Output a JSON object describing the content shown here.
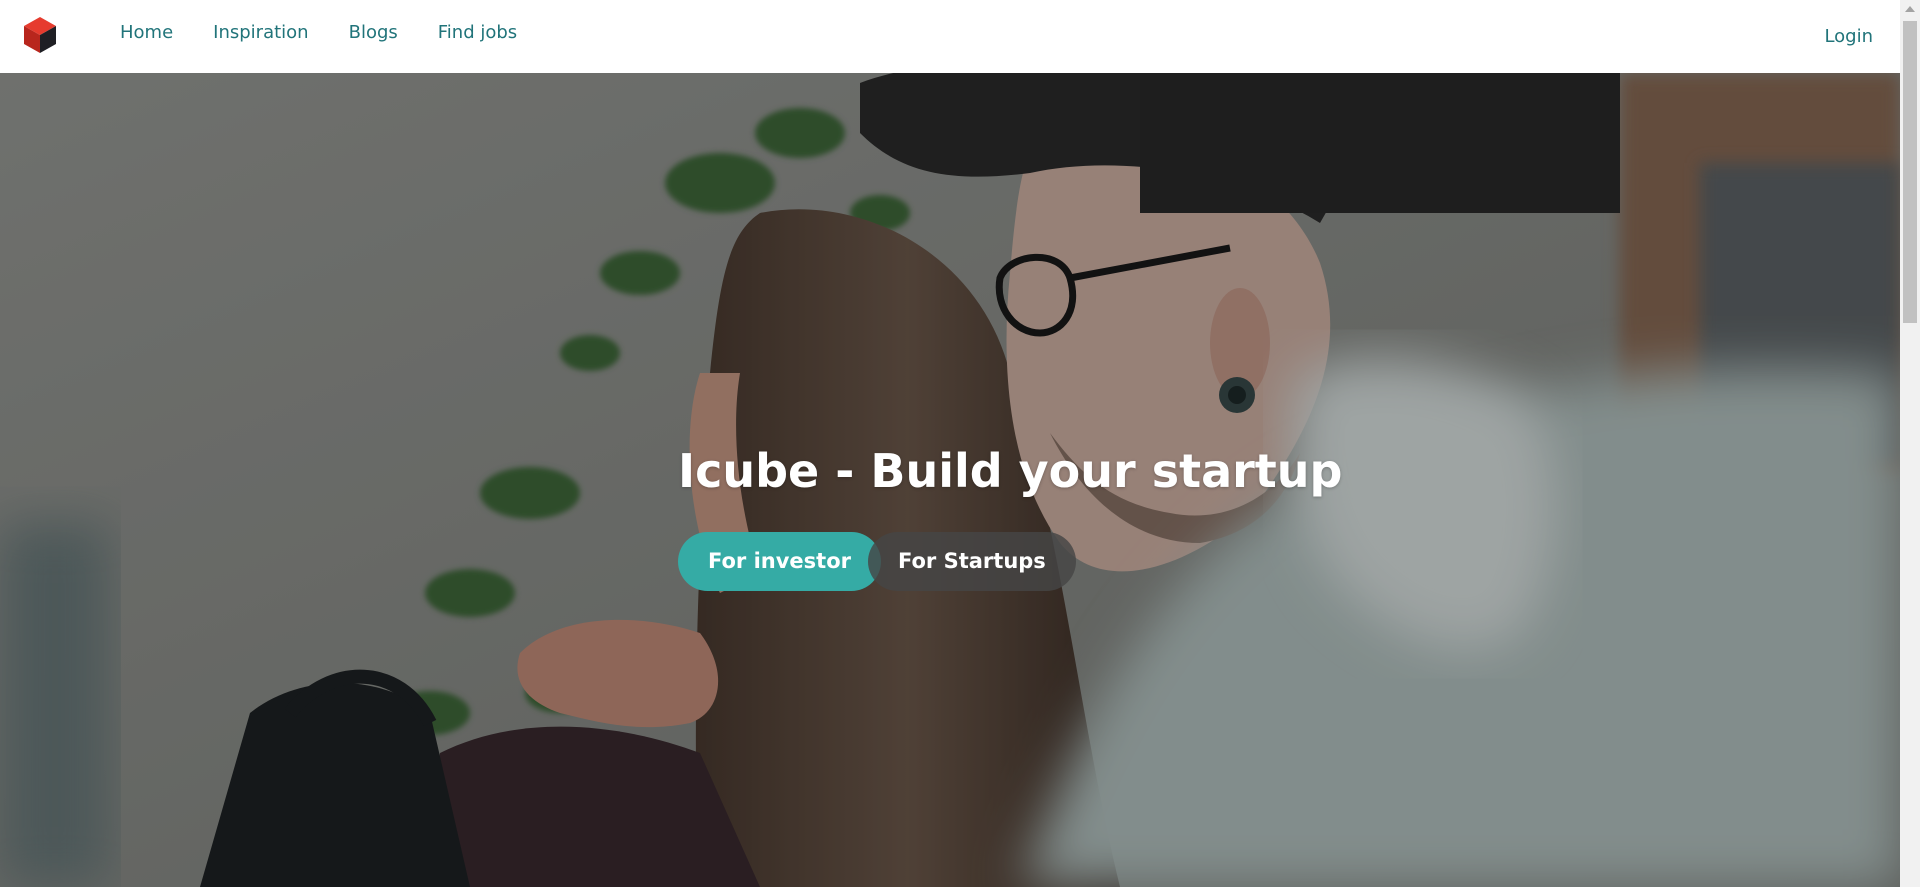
{
  "brand": {
    "logo_icon": "red-cube-logo",
    "colors": {
      "cube_red": "#e63b2e",
      "cube_dark": "#1f1f24",
      "accent_teal": "#35aba5",
      "link_teal": "#21747a"
    }
  },
  "nav": {
    "items": [
      {
        "label": "Home"
      },
      {
        "label": "Inspiration"
      },
      {
        "label": "Blogs"
      },
      {
        "label": "Find jobs"
      }
    ],
    "login_label": "Login"
  },
  "hero": {
    "title": "Icube - Build your startup",
    "investor_button": "For investor",
    "startups_button": "For Startups",
    "background": "photo-two-people-working"
  }
}
